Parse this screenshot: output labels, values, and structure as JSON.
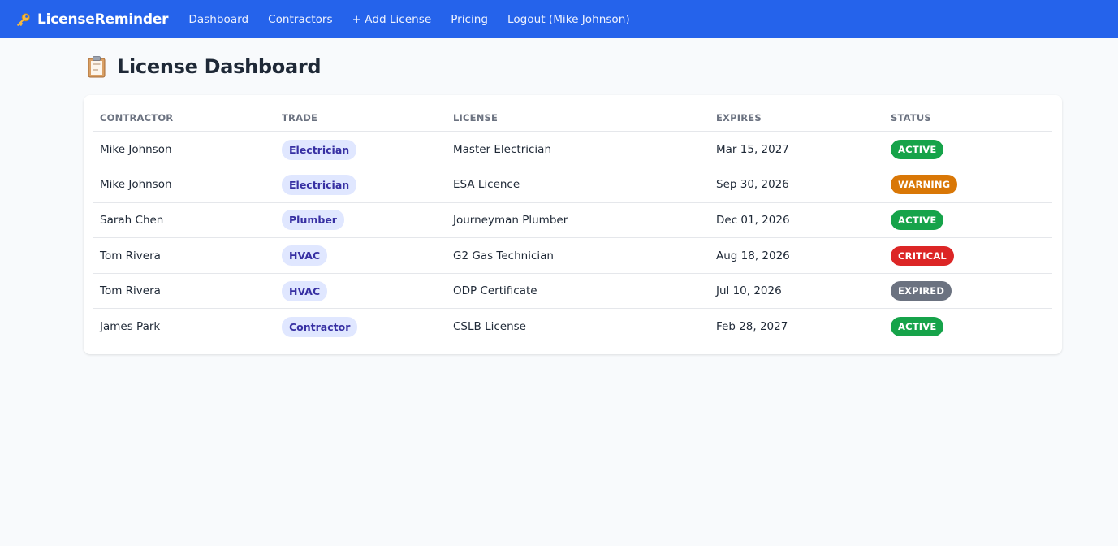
{
  "nav": {
    "brand": "LicenseReminder",
    "links": [
      "Dashboard",
      "Contractors",
      "+ Add License",
      "Pricing",
      "Logout (Mike Johnson)"
    ]
  },
  "page": {
    "title": "License Dashboard"
  },
  "table": {
    "headers": [
      "CONTRACTOR",
      "TRADE",
      "LICENSE",
      "EXPIRES",
      "STATUS"
    ],
    "rows": [
      {
        "contractor": "Mike Johnson",
        "trade": "Electrician",
        "license": "Master Electrician",
        "expires": "Mar 15, 2027",
        "status": "ACTIVE"
      },
      {
        "contractor": "Mike Johnson",
        "trade": "Electrician",
        "license": "ESA Licence",
        "expires": "Sep 30, 2026",
        "status": "WARNING"
      },
      {
        "contractor": "Sarah Chen",
        "trade": "Plumber",
        "license": "Journeyman Plumber",
        "expires": "Dec 01, 2026",
        "status": "ACTIVE"
      },
      {
        "contractor": "Tom Rivera",
        "trade": "HVAC",
        "license": "G2 Gas Technician",
        "expires": "Aug 18, 2026",
        "status": "CRITICAL"
      },
      {
        "contractor": "Tom Rivera",
        "trade": "HVAC",
        "license": "ODP Certificate",
        "expires": "Jul 10, 2026",
        "status": "EXPIRED"
      },
      {
        "contractor": "James Park",
        "trade": "Contractor",
        "license": "CSLB License",
        "expires": "Feb 28, 2027",
        "status": "ACTIVE"
      }
    ]
  },
  "status_colors": {
    "ACTIVE": "#16a34a",
    "WARNING": "#d97706",
    "CRITICAL": "#dc2626",
    "EXPIRED": "#6b7280"
  },
  "icons": {
    "brand": "key-icon",
    "title": "clipboard-icon"
  }
}
